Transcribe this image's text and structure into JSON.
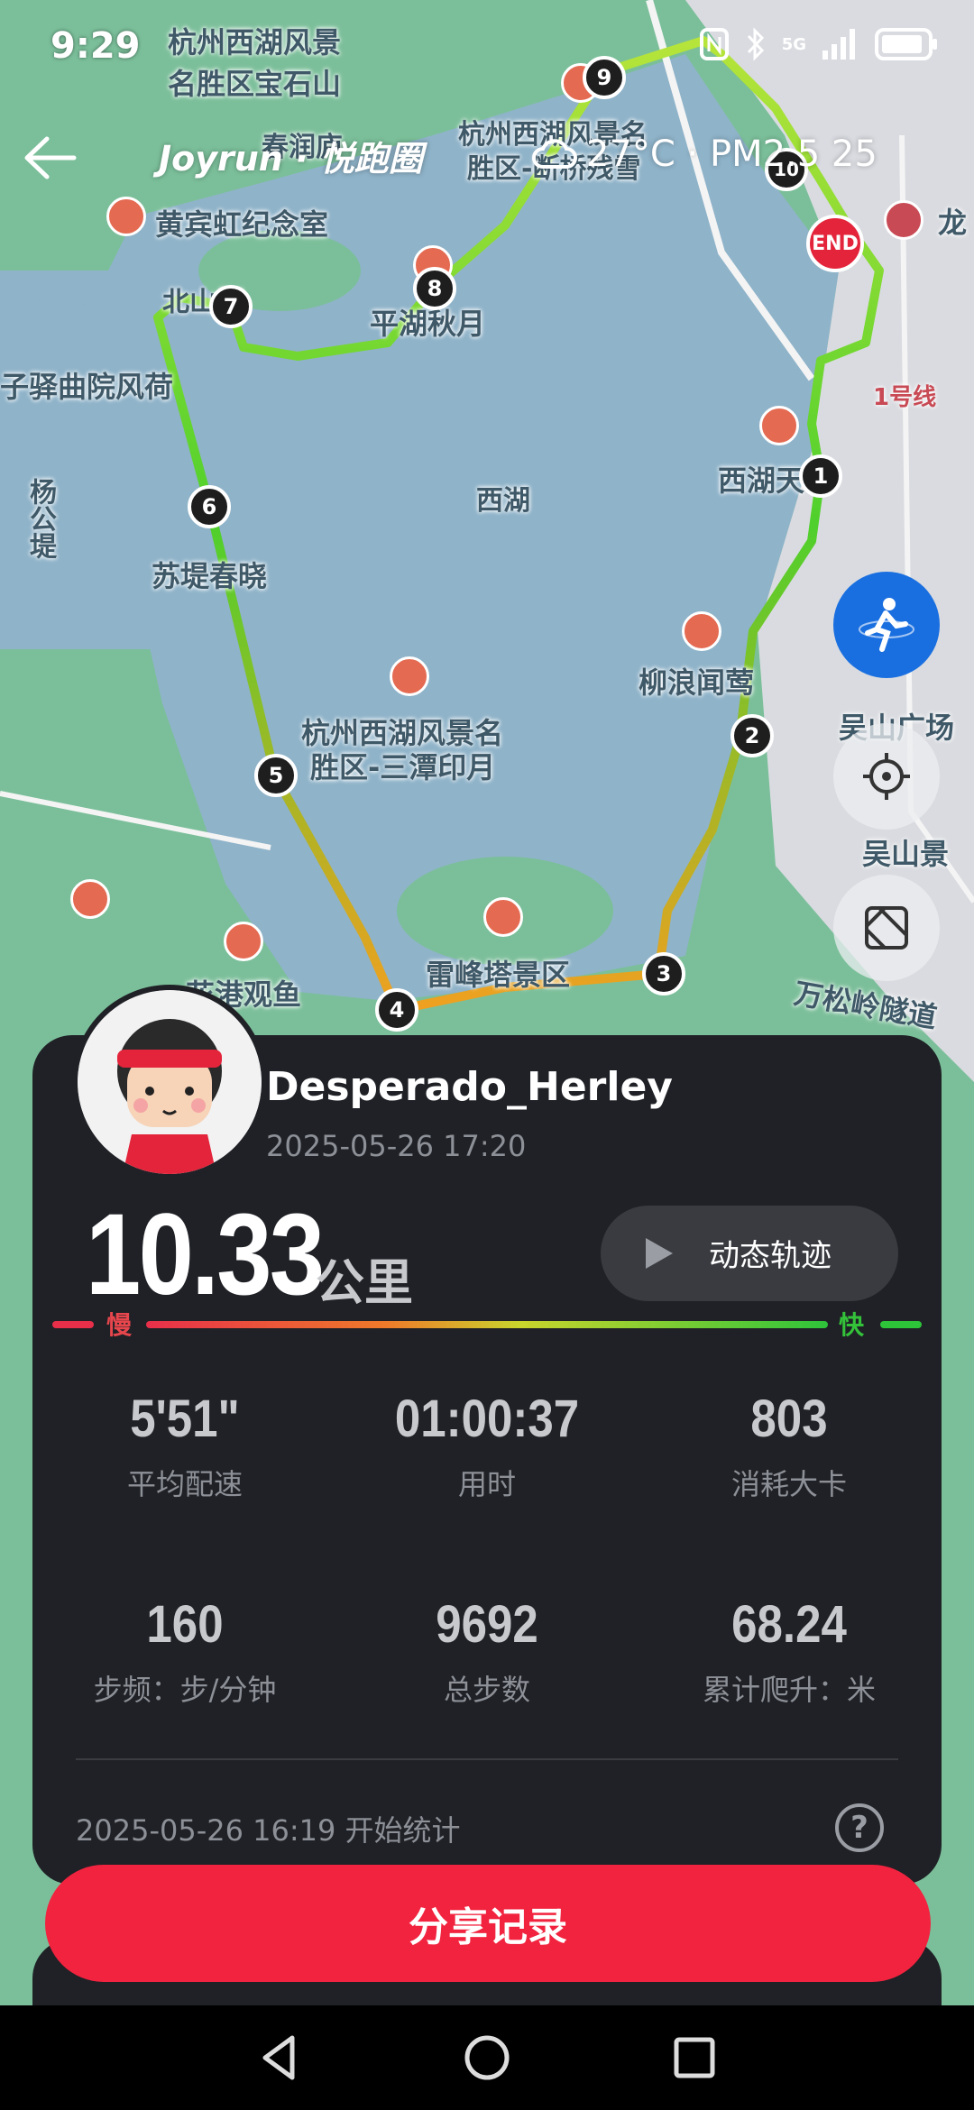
{
  "status_bar": {
    "time": "9:29",
    "network": "5G"
  },
  "header": {
    "brand": "Joyrun · 悦跑圈",
    "weather": "27°C · PM2.5 25"
  },
  "map": {
    "labels": [
      "杭州西湖风景",
      "名胜区宝石山",
      "春润庐",
      "杭州西湖风景名",
      "胜区-断桥残雪",
      "黄宾虹纪念室",
      "北山街",
      "平湖秋月",
      "子驿曲院风荷",
      "西湖",
      "杨公堤",
      "苏堤春晓",
      "西湖天地",
      "柳浪闻莺",
      "杭州西湖风景名",
      "胜区-三潭印月",
      "吴山广场",
      "雷峰塔景区",
      "花港观鱼",
      "万松岭隧道",
      "吴山景",
      "1号线",
      "龙"
    ],
    "markers": [
      "1",
      "2",
      "3",
      "4",
      "5",
      "6",
      "7",
      "8",
      "9",
      "10"
    ],
    "end_label": "END"
  },
  "profile": {
    "username": "Desperado_Herley",
    "datetime": "2025-05-26 17:20"
  },
  "run": {
    "distance": "10.33",
    "unit": "公里",
    "replay_label": "动态轨迹",
    "slow_label": "慢",
    "fast_label": "快",
    "stats": [
      {
        "value": "5'51\"",
        "label": "平均配速"
      },
      {
        "value": "01:00:37",
        "label": "用时"
      },
      {
        "value": "803",
        "label": "消耗大卡"
      },
      {
        "value": "160",
        "label": "步频：步/分钟"
      },
      {
        "value": "9692",
        "label": "总步数"
      },
      {
        "value": "68.24",
        "label": "累计爬升：米"
      }
    ],
    "start_text": "2025-05-26 16:19  开始统计",
    "help": "?"
  },
  "share_label": "分享记录",
  "colors": {
    "accent": "#f2233f",
    "card": "#1f2126",
    "blue_button": "#1a6fe0"
  }
}
